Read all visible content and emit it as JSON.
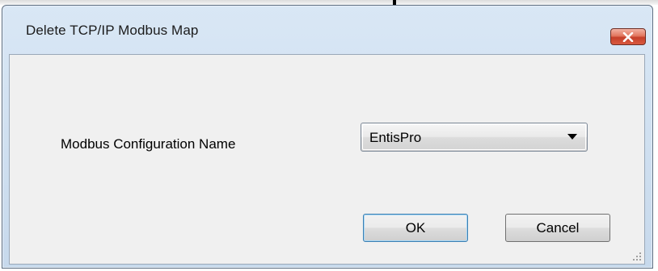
{
  "dialog": {
    "title": "Delete TCP/IP Modbus Map",
    "field_label": "Modbus Configuration Name",
    "combo_value": "EntisPro",
    "ok_label": "OK",
    "cancel_label": "Cancel"
  },
  "icons": {
    "close": "close-icon",
    "dropdown": "chevron-down-icon",
    "resize": "resize-grip-icon"
  },
  "colors": {
    "frame": "#c7d9ec",
    "client": "#f0f0f0",
    "close_button": "#c5402a",
    "default_button_border": "#3c7fb1"
  }
}
